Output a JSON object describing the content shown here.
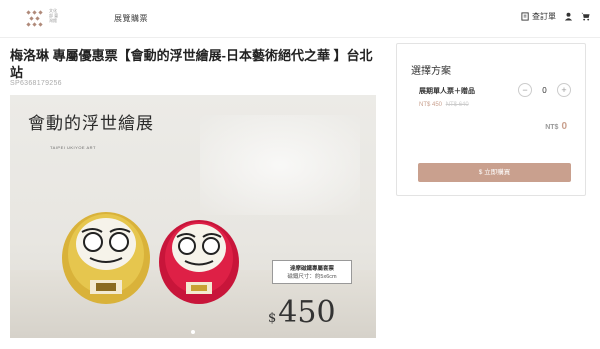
{
  "header": {
    "logo_text": "文化部 臺灣館",
    "nav_label": "展覽購票",
    "orders_label": "查訂單",
    "icons": [
      "orders-icon",
      "user-icon",
      "cart-icon"
    ]
  },
  "product": {
    "title": "梅洛琳 專屬優惠票【會動的浮世繪展-日本藝術絕代之華 】台北站",
    "sku": "SP6368179256",
    "image": {
      "poster_title": "會動的浮世繪展",
      "poster_subtitle": "TAIPEI UKIYOE ART",
      "tag_line1": "達摩磁鐵專屬套票",
      "tag_line2": "磁鐵尺寸：約5x6cm",
      "price_currency": "$",
      "price_value": "450"
    }
  },
  "plan": {
    "heading": "選擇方案",
    "option_name": "展期單人票＋贈品",
    "option_price": "NT$ 450",
    "option_original_price": "NT$ 640",
    "decrement": "−",
    "quantity": "0",
    "increment": "+",
    "total_label": "NT$",
    "total_value": "0",
    "buy_label": "$ 立即購買"
  },
  "colors": {
    "accent": "#c9a08e",
    "border": "#e3e3e3",
    "title": "#222222"
  }
}
